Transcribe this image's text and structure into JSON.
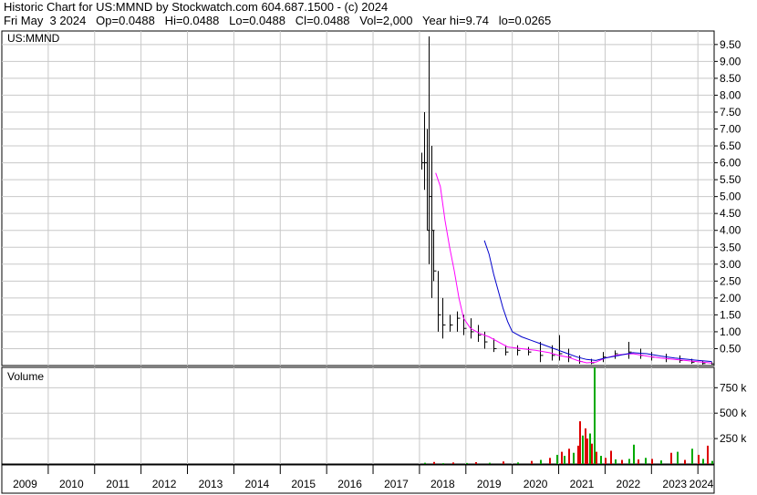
{
  "header": {
    "line1": "Historic Chart for US:MMND by Stockwatch.com 604.687.1500 - (c) 2024",
    "line2": "Fri May  3 2024   Op=0.0488   Hi=0.0488   Lo=0.0488   Cl=0.0488   Vol=2,000   Year hi=9.74   lo=0.0265"
  },
  "colors": {
    "price": "#000000",
    "ma_fast": "#ff00ff",
    "ma_slow": "#0000cc",
    "vol_up": "#00aa00",
    "vol_down": "#dd0000",
    "grid": "#c8c8c8"
  },
  "chart_data": [
    {
      "type": "line",
      "title": "US:MMND",
      "xlabel": "",
      "ylabel": "",
      "x_ticks": [
        "2009",
        "2010",
        "2011",
        "2012",
        "2013",
        "2014",
        "2015",
        "2016",
        "2017",
        "2018",
        "2019",
        "2020",
        "2021",
        "2022",
        "2023",
        "2024"
      ],
      "xlim": [
        2009.0,
        2024.35
      ],
      "ylim": [
        0,
        9.9
      ],
      "y_ticks": [
        0.5,
        1.0,
        1.5,
        2.0,
        2.5,
        3.0,
        3.5,
        4.0,
        4.5,
        5.0,
        5.5,
        6.0,
        6.5,
        7.0,
        7.5,
        8.0,
        8.5,
        9.0,
        9.5
      ],
      "grid": true,
      "series": [
        {
          "kind": "ohlc",
          "bars": [
            {
              "x": 2018.05,
              "h": 6.3,
              "l": 5.8,
              "c": 6.0
            },
            {
              "x": 2018.1,
              "h": 7.5,
              "l": 5.2,
              "c": 6.0
            },
            {
              "x": 2018.15,
              "h": 7.0,
              "l": 4.0,
              "c": 4.0
            },
            {
              "x": 2018.2,
              "h": 9.74,
              "l": 3.0,
              "c": 5.0
            },
            {
              "x": 2018.25,
              "h": 6.5,
              "l": 2.0,
              "c": 4.0
            },
            {
              "x": 2018.3,
              "h": 4.0,
              "l": 2.5,
              "c": 2.8
            },
            {
              "x": 2018.4,
              "h": 2.8,
              "l": 1.0,
              "c": 1.5
            },
            {
              "x": 2018.5,
              "h": 2.0,
              "l": 0.8,
              "c": 1.2
            },
            {
              "x": 2018.65,
              "h": 1.5,
              "l": 1.0,
              "c": 1.2
            },
            {
              "x": 2018.8,
              "h": 1.6,
              "l": 1.0,
              "c": 1.4
            },
            {
              "x": 2018.95,
              "h": 1.5,
              "l": 0.9,
              "c": 1.1
            },
            {
              "x": 2019.1,
              "h": 1.4,
              "l": 0.8,
              "c": 1.0
            },
            {
              "x": 2019.25,
              "h": 1.2,
              "l": 0.7,
              "c": 0.9
            },
            {
              "x": 2019.4,
              "h": 1.0,
              "l": 0.5,
              "c": 0.7
            },
            {
              "x": 2019.6,
              "h": 0.8,
              "l": 0.4,
              "c": 0.5
            },
            {
              "x": 2019.85,
              "h": 0.6,
              "l": 0.3,
              "c": 0.4
            },
            {
              "x": 2020.1,
              "h": 0.6,
              "l": 0.3,
              "c": 0.45
            },
            {
              "x": 2020.35,
              "h": 0.55,
              "l": 0.3,
              "c": 0.4
            },
            {
              "x": 2020.6,
              "h": 0.7,
              "l": 0.1,
              "c": 0.3
            },
            {
              "x": 2020.85,
              "h": 0.6,
              "l": 0.15,
              "c": 0.3
            },
            {
              "x": 2021.0,
              "h": 0.9,
              "l": 0.15,
              "c": 0.35
            },
            {
              "x": 2021.2,
              "h": 0.5,
              "l": 0.1,
              "c": 0.25
            },
            {
              "x": 2021.45,
              "h": 0.3,
              "l": 0.05,
              "c": 0.12
            },
            {
              "x": 2021.7,
              "h": 0.2,
              "l": 0.04,
              "c": 0.08
            },
            {
              "x": 2021.95,
              "h": 0.4,
              "l": 0.1,
              "c": 0.25
            },
            {
              "x": 2022.2,
              "h": 0.45,
              "l": 0.2,
              "c": 0.35
            },
            {
              "x": 2022.5,
              "h": 0.7,
              "l": 0.2,
              "c": 0.4
            },
            {
              "x": 2022.75,
              "h": 0.5,
              "l": 0.2,
              "c": 0.3
            },
            {
              "x": 2023.0,
              "h": 0.4,
              "l": 0.15,
              "c": 0.25
            },
            {
              "x": 2023.3,
              "h": 0.35,
              "l": 0.1,
              "c": 0.2
            },
            {
              "x": 2023.6,
              "h": 0.3,
              "l": 0.08,
              "c": 0.15
            },
            {
              "x": 2023.85,
              "h": 0.2,
              "l": 0.05,
              "c": 0.1
            },
            {
              "x": 2024.1,
              "h": 0.15,
              "l": 0.03,
              "c": 0.06
            },
            {
              "x": 2024.3,
              "h": 0.1,
              "l": 0.03,
              "c": 0.05
            }
          ]
        },
        {
          "kind": "ma_fast",
          "points": [
            [
              2018.35,
              5.7
            ],
            [
              2018.45,
              5.3
            ],
            [
              2018.55,
              4.3
            ],
            [
              2018.65,
              3.5
            ],
            [
              2018.75,
              2.8
            ],
            [
              2018.85,
              2.0
            ],
            [
              2018.95,
              1.4
            ],
            [
              2019.1,
              1.1
            ],
            [
              2019.3,
              0.95
            ],
            [
              2019.5,
              0.85
            ],
            [
              2019.7,
              0.7
            ],
            [
              2019.9,
              0.55
            ],
            [
              2020.2,
              0.5
            ],
            [
              2020.5,
              0.45
            ],
            [
              2020.8,
              0.38
            ],
            [
              2021.0,
              0.3
            ],
            [
              2021.2,
              0.25
            ],
            [
              2021.4,
              0.15
            ],
            [
              2021.6,
              0.08
            ],
            [
              2021.8,
              0.1
            ],
            [
              2022.0,
              0.22
            ],
            [
              2022.3,
              0.32
            ],
            [
              2022.6,
              0.35
            ],
            [
              2022.9,
              0.28
            ],
            [
              2023.2,
              0.22
            ],
            [
              2023.5,
              0.18
            ],
            [
              2023.8,
              0.14
            ],
            [
              2024.1,
              0.1
            ],
            [
              2024.3,
              0.07
            ]
          ]
        },
        {
          "kind": "ma_slow",
          "points": [
            [
              2019.4,
              3.7
            ],
            [
              2019.5,
              3.3
            ],
            [
              2019.6,
              2.7
            ],
            [
              2019.7,
              2.2
            ],
            [
              2019.8,
              1.7
            ],
            [
              2019.9,
              1.3
            ],
            [
              2020.0,
              1.0
            ],
            [
              2020.2,
              0.85
            ],
            [
              2020.4,
              0.75
            ],
            [
              2020.6,
              0.65
            ],
            [
              2020.8,
              0.55
            ],
            [
              2021.0,
              0.45
            ],
            [
              2021.2,
              0.35
            ],
            [
              2021.4,
              0.25
            ],
            [
              2021.6,
              0.18
            ],
            [
              2021.8,
              0.15
            ],
            [
              2022.0,
              0.22
            ],
            [
              2022.3,
              0.3
            ],
            [
              2022.6,
              0.38
            ],
            [
              2022.9,
              0.35
            ],
            [
              2023.2,
              0.28
            ],
            [
              2023.5,
              0.22
            ],
            [
              2023.8,
              0.18
            ],
            [
              2024.1,
              0.14
            ],
            [
              2024.3,
              0.12
            ]
          ]
        }
      ]
    },
    {
      "type": "bar",
      "title": "Volume",
      "ylim": [
        0,
        950
      ],
      "y_ticks": [
        250,
        500,
        750
      ],
      "y_tick_labels": [
        "250 k",
        "500 k",
        "750 k"
      ],
      "x_ticks": [
        "2009",
        "2010",
        "2011",
        "2012",
        "2013",
        "2014",
        "2015",
        "2016",
        "2017",
        "2018",
        "2019",
        "2020",
        "2021",
        "2022",
        "2023",
        "2024"
      ],
      "xlim": [
        2009.0,
        2024.35
      ],
      "bars": [
        {
          "x": 2018.1,
          "v": 12,
          "up": true
        },
        {
          "x": 2018.3,
          "v": 20,
          "up": false
        },
        {
          "x": 2018.5,
          "v": 8,
          "up": true
        },
        {
          "x": 2018.7,
          "v": 15,
          "up": false
        },
        {
          "x": 2019.0,
          "v": 10,
          "up": true
        },
        {
          "x": 2019.2,
          "v": 18,
          "up": false
        },
        {
          "x": 2019.5,
          "v": 12,
          "up": true
        },
        {
          "x": 2019.8,
          "v": 25,
          "up": false
        },
        {
          "x": 2020.1,
          "v": 15,
          "up": true
        },
        {
          "x": 2020.4,
          "v": 30,
          "up": false
        },
        {
          "x": 2020.6,
          "v": 40,
          "up": true
        },
        {
          "x": 2020.8,
          "v": 60,
          "up": false
        },
        {
          "x": 2020.95,
          "v": 90,
          "up": true
        },
        {
          "x": 2021.05,
          "v": 120,
          "up": false
        },
        {
          "x": 2021.1,
          "v": 80,
          "up": true
        },
        {
          "x": 2021.2,
          "v": 150,
          "up": false
        },
        {
          "x": 2021.3,
          "v": 110,
          "up": true
        },
        {
          "x": 2021.4,
          "v": 180,
          "up": false
        },
        {
          "x": 2021.45,
          "v": 420,
          "up": false
        },
        {
          "x": 2021.5,
          "v": 280,
          "up": true
        },
        {
          "x": 2021.55,
          "v": 350,
          "up": false
        },
        {
          "x": 2021.6,
          "v": 250,
          "up": false
        },
        {
          "x": 2021.65,
          "v": 300,
          "up": true
        },
        {
          "x": 2021.7,
          "v": 200,
          "up": false
        },
        {
          "x": 2021.75,
          "v": 950,
          "up": true
        },
        {
          "x": 2021.8,
          "v": 120,
          "up": false
        },
        {
          "x": 2021.9,
          "v": 80,
          "up": true
        },
        {
          "x": 2022.0,
          "v": 60,
          "up": false
        },
        {
          "x": 2022.1,
          "v": 130,
          "up": false
        },
        {
          "x": 2022.2,
          "v": 45,
          "up": true
        },
        {
          "x": 2022.35,
          "v": 40,
          "up": false
        },
        {
          "x": 2022.5,
          "v": 50,
          "up": true
        },
        {
          "x": 2022.6,
          "v": 190,
          "up": true
        },
        {
          "x": 2022.7,
          "v": 45,
          "up": false
        },
        {
          "x": 2022.85,
          "v": 60,
          "up": true
        },
        {
          "x": 2023.0,
          "v": 50,
          "up": false
        },
        {
          "x": 2023.2,
          "v": 35,
          "up": true
        },
        {
          "x": 2023.4,
          "v": 110,
          "up": false
        },
        {
          "x": 2023.55,
          "v": 120,
          "up": true
        },
        {
          "x": 2023.7,
          "v": 40,
          "up": false
        },
        {
          "x": 2023.85,
          "v": 150,
          "up": true
        },
        {
          "x": 2024.0,
          "v": 90,
          "up": false
        },
        {
          "x": 2024.1,
          "v": 50,
          "up": true
        },
        {
          "x": 2024.2,
          "v": 180,
          "up": false
        },
        {
          "x": 2024.3,
          "v": 30,
          "up": true
        }
      ]
    }
  ]
}
